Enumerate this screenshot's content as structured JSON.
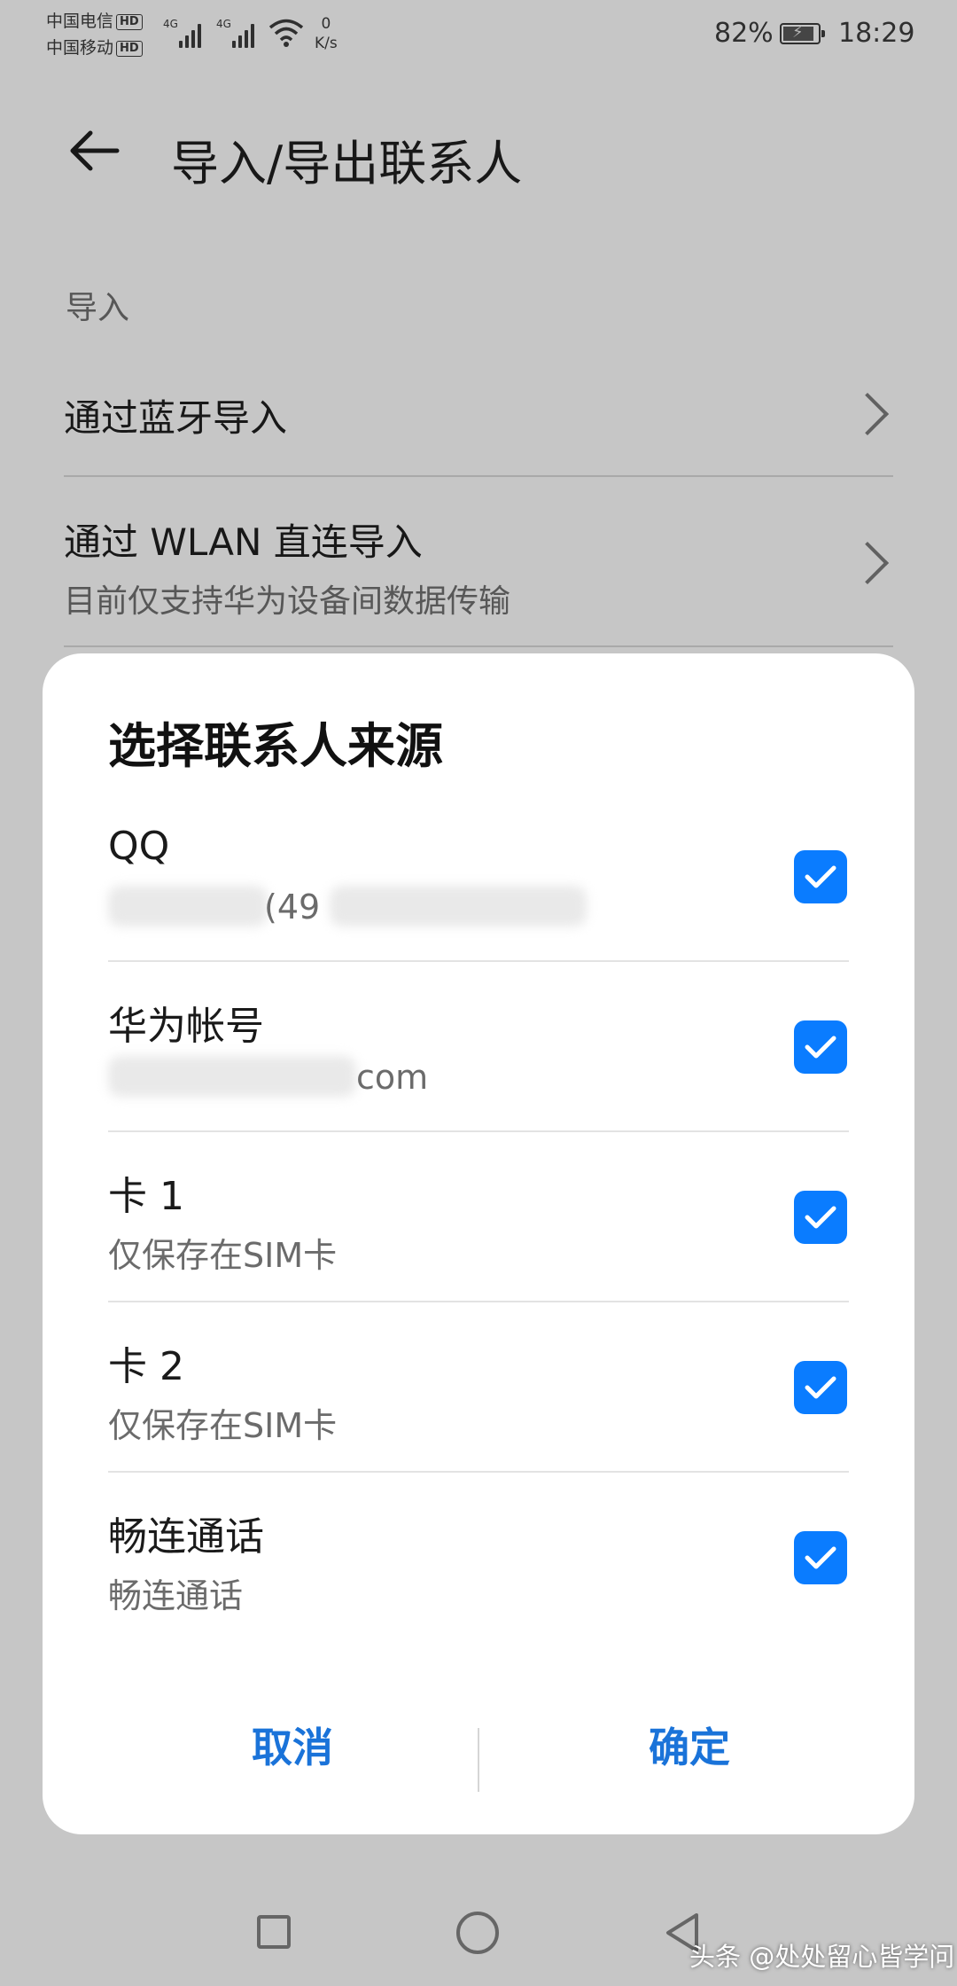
{
  "status_bar": {
    "carrier1": "中国电信",
    "carrier2": "中国移动",
    "hd": "HD",
    "net1": "4G",
    "net2": "4G",
    "speed_value": "0",
    "speed_unit": "K/s",
    "battery": "82%",
    "battery_level": 0.82,
    "time": "18:29"
  },
  "header": {
    "title": "导入/导出联系人"
  },
  "page": {
    "section_import": "导入",
    "items": [
      {
        "label": "通过蓝牙导入"
      },
      {
        "label": "通过 WLAN 直连导入",
        "sub": "目前仅支持华为设备间数据传输"
      }
    ]
  },
  "dialog": {
    "title": "选择联系人来源",
    "options": [
      {
        "name": "QQ",
        "sub": "(49",
        "checked": true
      },
      {
        "name": "华为帐号",
        "sub": "com",
        "checked": true
      },
      {
        "name": "卡 1",
        "sub": "仅保存在SIM卡",
        "checked": true
      },
      {
        "name": "卡 2",
        "sub": "仅保存在SIM卡",
        "checked": true
      },
      {
        "name": "畅连通话",
        "sub": "畅连通话",
        "checked": true
      }
    ],
    "cancel": "取消",
    "confirm": "确定"
  },
  "watermark": "头条 @处处留心皆学问",
  "colors": {
    "accent": "#0a7cff",
    "button_text": "#1a73d9"
  }
}
